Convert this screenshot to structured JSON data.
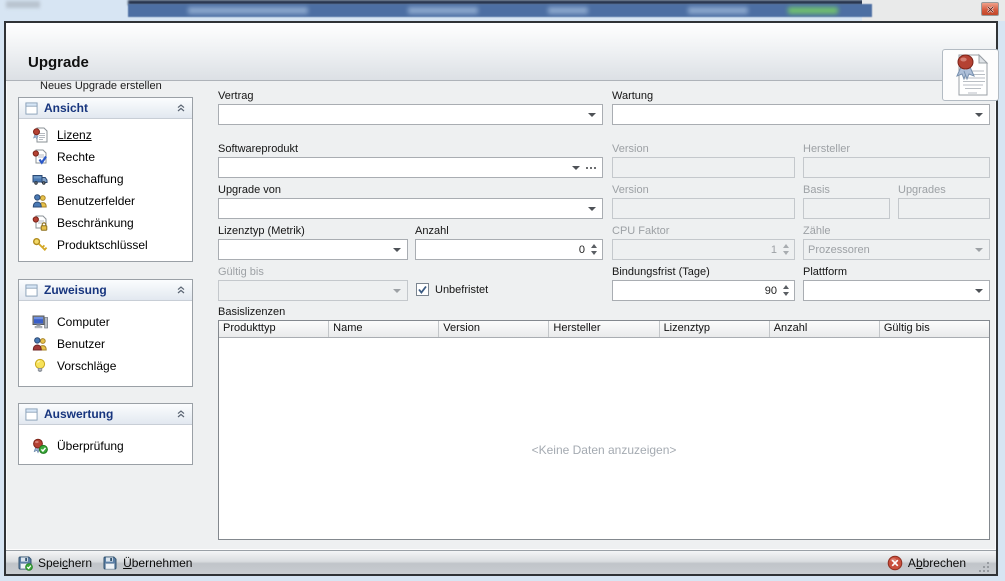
{
  "window": {
    "title": "Upgrade",
    "subtitle": "Neues Upgrade erstellen"
  },
  "sidebar": {
    "groups": [
      {
        "title": "Ansicht",
        "items": [
          {
            "label": "Lizenz",
            "icon": "license-icon",
            "active": true
          },
          {
            "label": "Rechte",
            "icon": "rights-icon",
            "active": false
          },
          {
            "label": "Beschaffung",
            "icon": "truck-icon",
            "active": false
          },
          {
            "label": "Benutzerfelder",
            "icon": "users-icon",
            "active": false
          },
          {
            "label": "Beschränkung",
            "icon": "restriction-lock-icon",
            "active": false
          },
          {
            "label": "Produktschlüssel",
            "icon": "key-icon",
            "active": false
          }
        ]
      },
      {
        "title": "Zuweisung",
        "items": [
          {
            "label": "Computer",
            "icon": "computer-icon",
            "active": false
          },
          {
            "label": "Benutzer",
            "icon": "users-icon",
            "active": false
          },
          {
            "label": "Vorschläge",
            "icon": "lightbulb-icon",
            "active": false
          }
        ]
      },
      {
        "title": "Auswertung",
        "items": [
          {
            "label": "Überprüfung",
            "icon": "verify-seal-icon",
            "active": false
          }
        ]
      }
    ]
  },
  "form": {
    "vertrag": {
      "label": "Vertrag",
      "value": "",
      "state": "enabled"
    },
    "wartung": {
      "label": "Wartung",
      "value": "",
      "state": "enabled"
    },
    "softwareprodukt": {
      "label": "Softwareprodukt",
      "value": "",
      "state": "enabled"
    },
    "version_produkt": {
      "label": "Version",
      "value": "",
      "state": "disabled"
    },
    "hersteller": {
      "label": "Hersteller",
      "value": "",
      "state": "disabled"
    },
    "upgrade_von": {
      "label": "Upgrade von",
      "value": "",
      "state": "enabled"
    },
    "version_upgrade": {
      "label": "Version",
      "value": "",
      "state": "disabled"
    },
    "basis": {
      "label": "Basis",
      "value": "",
      "state": "disabled"
    },
    "upgrades": {
      "label": "Upgrades",
      "value": "",
      "state": "disabled"
    },
    "lizenztyp": {
      "label": "Lizenztyp (Metrik)",
      "value": "",
      "state": "enabled"
    },
    "anzahl": {
      "label": "Anzahl",
      "value": "0",
      "state": "enabled"
    },
    "cpu_faktor": {
      "label": "CPU Faktor",
      "value": "1",
      "state": "disabled"
    },
    "zaehle": {
      "label": "Zähle",
      "value": "Prozessoren",
      "state": "disabled"
    },
    "gueltig_bis": {
      "label": "Gültig bis",
      "value": "",
      "state": "disabled"
    },
    "unbefristet": {
      "label": "Unbefristet",
      "checked": true
    },
    "bindungsfrist": {
      "label": "Bindungsfrist (Tage)",
      "value": "90",
      "state": "enabled"
    },
    "plattform": {
      "label": "Plattform",
      "value": "",
      "state": "enabled"
    }
  },
  "table": {
    "caption": "Basislizenzen",
    "columns": [
      "Produkttyp",
      "Name",
      "Version",
      "Hersteller",
      "Lizenztyp",
      "Anzahl",
      "Gültig bis"
    ],
    "rows": [],
    "empty_text": "<Keine Daten anzuzeigen>"
  },
  "footer": {
    "save": {
      "pre": "Spei",
      "accel": "c",
      "post": "hern"
    },
    "apply": {
      "pre": "",
      "accel": "Ü",
      "post": "bernehmen"
    },
    "cancel": {
      "pre": "A",
      "accel": "b",
      "post": "brechen"
    }
  },
  "icons": {
    "ellipsis": "…",
    "close": "✕",
    "chevron_down": "▾",
    "collapse_chevrons": "︽",
    "check": "✓",
    "save": "floppy-disk-green-check",
    "apply": "floppy-disk",
    "cancel": "red-circle-x",
    "header_art": "document-with-red-wax-seal"
  },
  "colors": {
    "group_title": "#17357e",
    "disabled_text": "#9da1a5",
    "seal_red": "#b44133",
    "check_green": "#3aa83a",
    "cancel_red": "#c94f3d",
    "dialog_bg": "#eef0f1",
    "bluebar_bg": "#4d6fa3"
  }
}
